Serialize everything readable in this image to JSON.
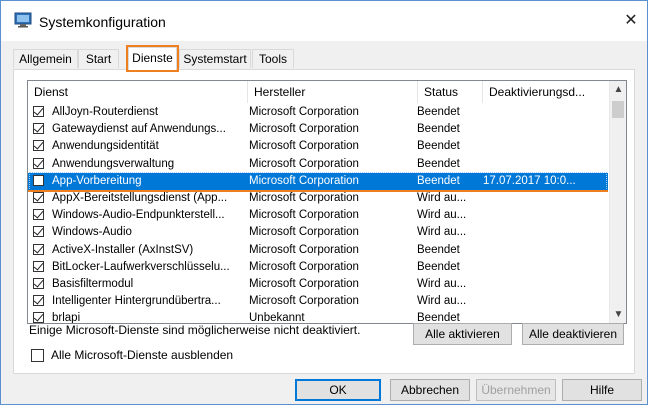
{
  "window": {
    "title": "Systemkonfiguration"
  },
  "tabs": [
    {
      "label": "Allgemein",
      "active": false
    },
    {
      "label": "Start",
      "active": false
    },
    {
      "label": "Dienste",
      "active": true
    },
    {
      "label": "Systemstart",
      "active": false
    },
    {
      "label": "Tools",
      "active": false
    }
  ],
  "columns": [
    "Dienst",
    "Hersteller",
    "Status",
    "Deaktivierungsd..."
  ],
  "services": [
    {
      "name": "AllJoyn-Routerdienst",
      "manufacturer": "Microsoft Corporation",
      "status": "Beendet",
      "date": "",
      "checked": true
    },
    {
      "name": "Gatewaydienst auf Anwendungs...",
      "manufacturer": "Microsoft Corporation",
      "status": "Beendet",
      "date": "",
      "checked": true
    },
    {
      "name": "Anwendungsidentität",
      "manufacturer": "Microsoft Corporation",
      "status": "Beendet",
      "date": "",
      "checked": true
    },
    {
      "name": "Anwendungsverwaltung",
      "manufacturer": "Microsoft Corporation",
      "status": "Beendet",
      "date": "",
      "checked": true
    },
    {
      "name": "App-Vorbereitung",
      "manufacturer": "Microsoft Corporation",
      "status": "Beendet",
      "date": "17.07.2017 10:0...",
      "checked": false,
      "selected": true
    },
    {
      "name": "AppX-Bereitstellungsdienst (App...",
      "manufacturer": "Microsoft Corporation",
      "status": "Wird au...",
      "date": "",
      "checked": true
    },
    {
      "name": "Windows-Audio-Endpunkterstell...",
      "manufacturer": "Microsoft Corporation",
      "status": "Wird au...",
      "date": "",
      "checked": true
    },
    {
      "name": "Windows-Audio",
      "manufacturer": "Microsoft Corporation",
      "status": "Wird au...",
      "date": "",
      "checked": true
    },
    {
      "name": "ActiveX-Installer (AxInstSV)",
      "manufacturer": "Microsoft Corporation",
      "status": "Beendet",
      "date": "",
      "checked": true
    },
    {
      "name": "BitLocker-Laufwerkverschlüsselu...",
      "manufacturer": "Microsoft Corporation",
      "status": "Beendet",
      "date": "",
      "checked": true
    },
    {
      "name": "Basisfiltermodul",
      "manufacturer": "Microsoft Corporation",
      "status": "Wird au...",
      "date": "",
      "checked": true
    },
    {
      "name": "Intelligenter Hintergrundübertra...",
      "manufacturer": "Microsoft Corporation",
      "status": "Wird au...",
      "date": "",
      "checked": true
    },
    {
      "name": "brlapi",
      "manufacturer": "Unbekannt",
      "status": "Beendet",
      "date": "",
      "checked": true
    }
  ],
  "note": "Einige Microsoft-Dienste sind möglicherweise nicht deaktiviert.",
  "buttons": {
    "enable_all": "Alle aktivieren",
    "disable_all": "Alle deaktivieren",
    "ok": "OK",
    "cancel": "Abbrechen",
    "apply": "Übernehmen",
    "help": "Hilfe"
  },
  "hide_ms_label": "Alle Microsoft-Dienste ausblenden",
  "colors": {
    "selection": "#0078d7",
    "highlight": "#f07f1f",
    "accent_border": "#0078d7"
  }
}
